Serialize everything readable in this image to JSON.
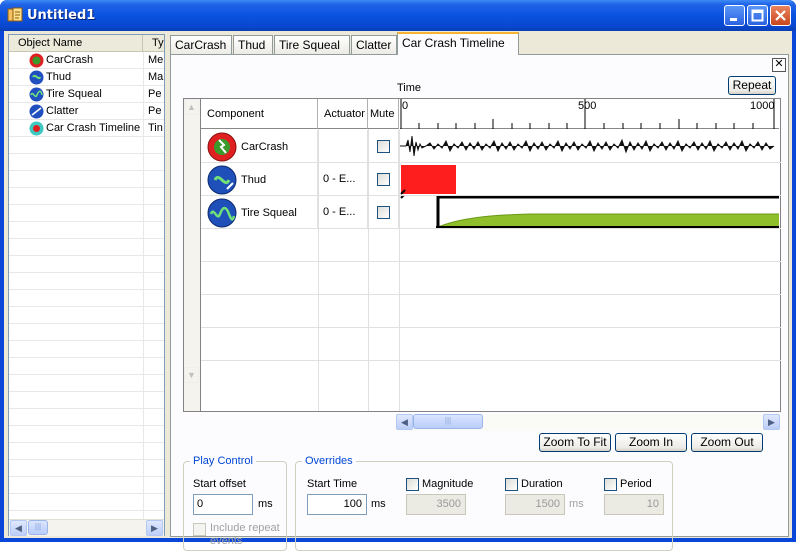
{
  "window": {
    "title": "Untitled1"
  },
  "tree": {
    "col_name": "Object Name",
    "col_type": "Ty",
    "items": [
      {
        "name": "CarCrash",
        "type": "Me",
        "icon": "carcrash-icon"
      },
      {
        "name": "Thud",
        "type": "Ma",
        "icon": "thud-icon"
      },
      {
        "name": "Tire Squeal",
        "type": "Pe",
        "icon": "tire-squeal-icon"
      },
      {
        "name": "Clatter",
        "type": "Pe",
        "icon": "clatter-icon"
      },
      {
        "name": "Car Crash Timeline",
        "type": "Tin",
        "icon": "timeline-icon"
      }
    ]
  },
  "tabs": [
    "CarCrash",
    "Thud",
    "Tire Squeal",
    "Clatter",
    "Car Crash Timeline"
  ],
  "active_tab": "Car Crash Timeline",
  "timeline": {
    "time_label": "Time",
    "repeat_label": "Repeat",
    "close_glyph": "✕",
    "columns": {
      "component": "Component",
      "actuator": "Actuator",
      "mute": "Mute"
    },
    "ruler": {
      "t0": "0",
      "t500": "500",
      "t1000": "1000"
    },
    "rows": [
      {
        "component": "CarCrash",
        "actuator": "",
        "muted": false
      },
      {
        "component": "Thud",
        "actuator": "0 - E...",
        "muted": false
      },
      {
        "component": "Tire Squeal",
        "actuator": "0 - E...",
        "muted": false
      }
    ],
    "zoom_to_fit": "Zoom To Fit",
    "zoom_in": "Zoom In",
    "zoom_out": "Zoom Out",
    "scroll_grip": "|||"
  },
  "play_control": {
    "title": "Play Control",
    "start_offset_label": "Start offset",
    "start_offset_value": "0",
    "unit": "ms",
    "include_repeat_line1": "Include repeat",
    "include_repeat_line2": "events"
  },
  "overrides": {
    "title": "Overrides",
    "start_time_label": "Start Time",
    "start_time_value": "100",
    "start_time_unit": "ms",
    "magnitude_label": "Magnitude",
    "magnitude_value": "3500",
    "duration_label": "Duration",
    "duration_value": "1500",
    "duration_unit": "ms",
    "period_label": "Period",
    "period_value": "10"
  },
  "colors": {
    "thud_bar": "#ff1e1e",
    "squeal_fill": "#8fbf2a",
    "accent_tab": "#f8b330"
  }
}
